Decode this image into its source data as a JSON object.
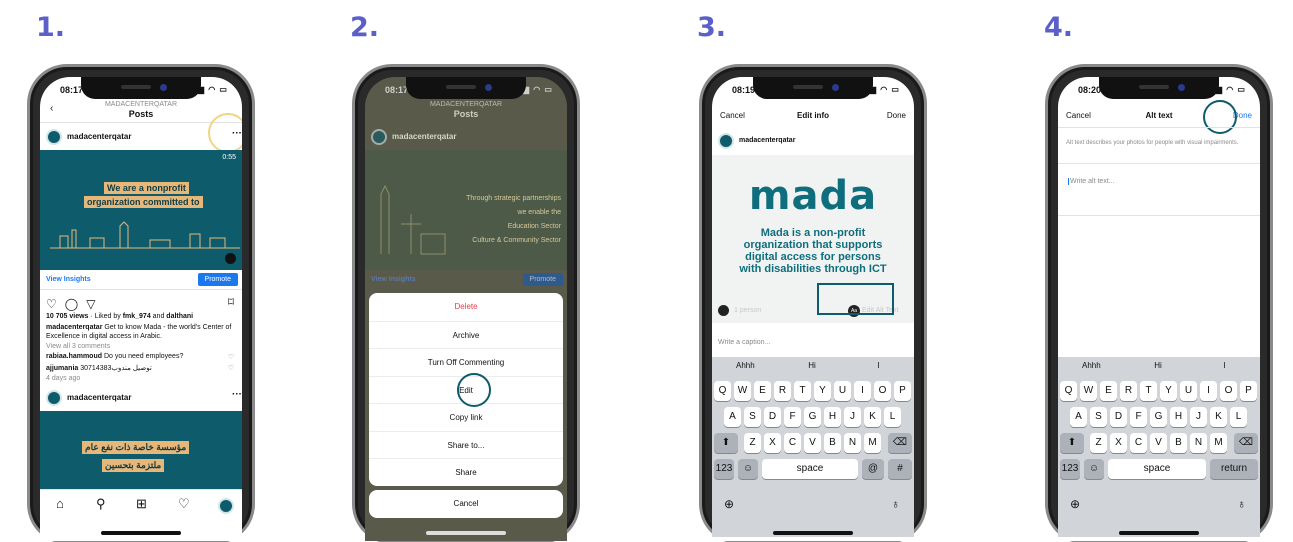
{
  "steps": [
    "1.",
    "2.",
    "3.",
    "4."
  ],
  "colors": {
    "step_number": "#5b5fc7",
    "brand_teal": "#0d5b6b",
    "brand_tan": "#e7b77a",
    "ios_blue": "#1b79f0",
    "delete_red": "#e0414f"
  },
  "phone1": {
    "time": "08:17",
    "nav_account": "MADACENTERQATAR",
    "nav_title": "Posts",
    "username": "madacenterqatar",
    "more": "···",
    "video_time": "0:55",
    "banner_line1": "We are a nonprofit",
    "banner_line2": "organization committed to",
    "view_insights": "View Insights",
    "promote": "Promote",
    "views_count": "10 705 views",
    "liked_by_prefix": " · Liked by ",
    "liked_user1": "fmk_974",
    "liked_and": " and ",
    "liked_user2": "dalthani",
    "caption_user": "madacenterqatar",
    "caption_text": " Get to know Mada - the world's Center of Excellence in digital access in Arabic.",
    "view_comments": "View all 3 comments",
    "comment1_user": "rabiaa.hammoud",
    "comment1_text": " Do you need employees?",
    "comment2_user": "ajjumania",
    "comment2_text": " توصيل مندوب30714383",
    "time_ago": "4 days ago",
    "username2": "madacenterqatar",
    "arabic_line1": "مؤسسة خاصة ذات نفع عام",
    "arabic_line2": "ملتزمة بتحسين",
    "tabs": [
      "home-icon",
      "search-icon",
      "plus-icon",
      "heart-icon",
      "profile-icon"
    ]
  },
  "phone2": {
    "time": "08:17",
    "nav_account": "MADACENTERQATAR",
    "nav_title": "Posts",
    "username": "madacenterqatar",
    "bg_lines": [
      "Through strategic partnerships",
      "we enable the",
      "Education Sector",
      "Culture & Community Sector"
    ],
    "view_insights": "View Insights",
    "promote": "Promote",
    "menu": [
      "Delete",
      "Archive",
      "Turn Off Commenting",
      "Edit",
      "Copy link",
      "Share to...",
      "Share"
    ],
    "cancel": "Cancel"
  },
  "phone3": {
    "time": "08:19",
    "cancel": "Cancel",
    "title": "Edit info",
    "done": "Done",
    "username": "madacenterqatar",
    "logo": "mada",
    "slogan": [
      "Mada is a non-profit",
      "organization that supports",
      "digital access for persons",
      "with disabilities through ICT"
    ],
    "tag_people": "1 person",
    "alt_text_btn": "Aa",
    "alt_text_label": "Edit Alt Text",
    "caption_placeholder": "Write a caption...",
    "suggestions": [
      "Ahhh",
      "Hi",
      "I"
    ],
    "row1": [
      "Q",
      "W",
      "E",
      "R",
      "T",
      "Y",
      "U",
      "I",
      "O",
      "P"
    ],
    "row2": [
      "A",
      "S",
      "D",
      "F",
      "G",
      "H",
      "J",
      "K",
      "L"
    ],
    "row3": [
      "Z",
      "X",
      "C",
      "V",
      "B",
      "N",
      "M"
    ],
    "key_123": "123",
    "key_space": "space",
    "key_at": "@",
    "key_hash": "#"
  },
  "phone4": {
    "time": "08:20",
    "cancel": "Cancel",
    "title": "Alt text",
    "done": "Done",
    "description": "Alt text describes your photos for people with visual impairments.",
    "placeholder": "Write alt text...",
    "suggestions": [
      "Ahhh",
      "Hi",
      "I"
    ],
    "row1": [
      "Q",
      "W",
      "E",
      "R",
      "T",
      "Y",
      "U",
      "I",
      "O",
      "P"
    ],
    "row2": [
      "A",
      "S",
      "D",
      "F",
      "G",
      "H",
      "J",
      "K",
      "L"
    ],
    "row3": [
      "Z",
      "X",
      "C",
      "V",
      "B",
      "N",
      "M"
    ],
    "key_123": "123",
    "key_space": "space",
    "key_return": "return"
  }
}
